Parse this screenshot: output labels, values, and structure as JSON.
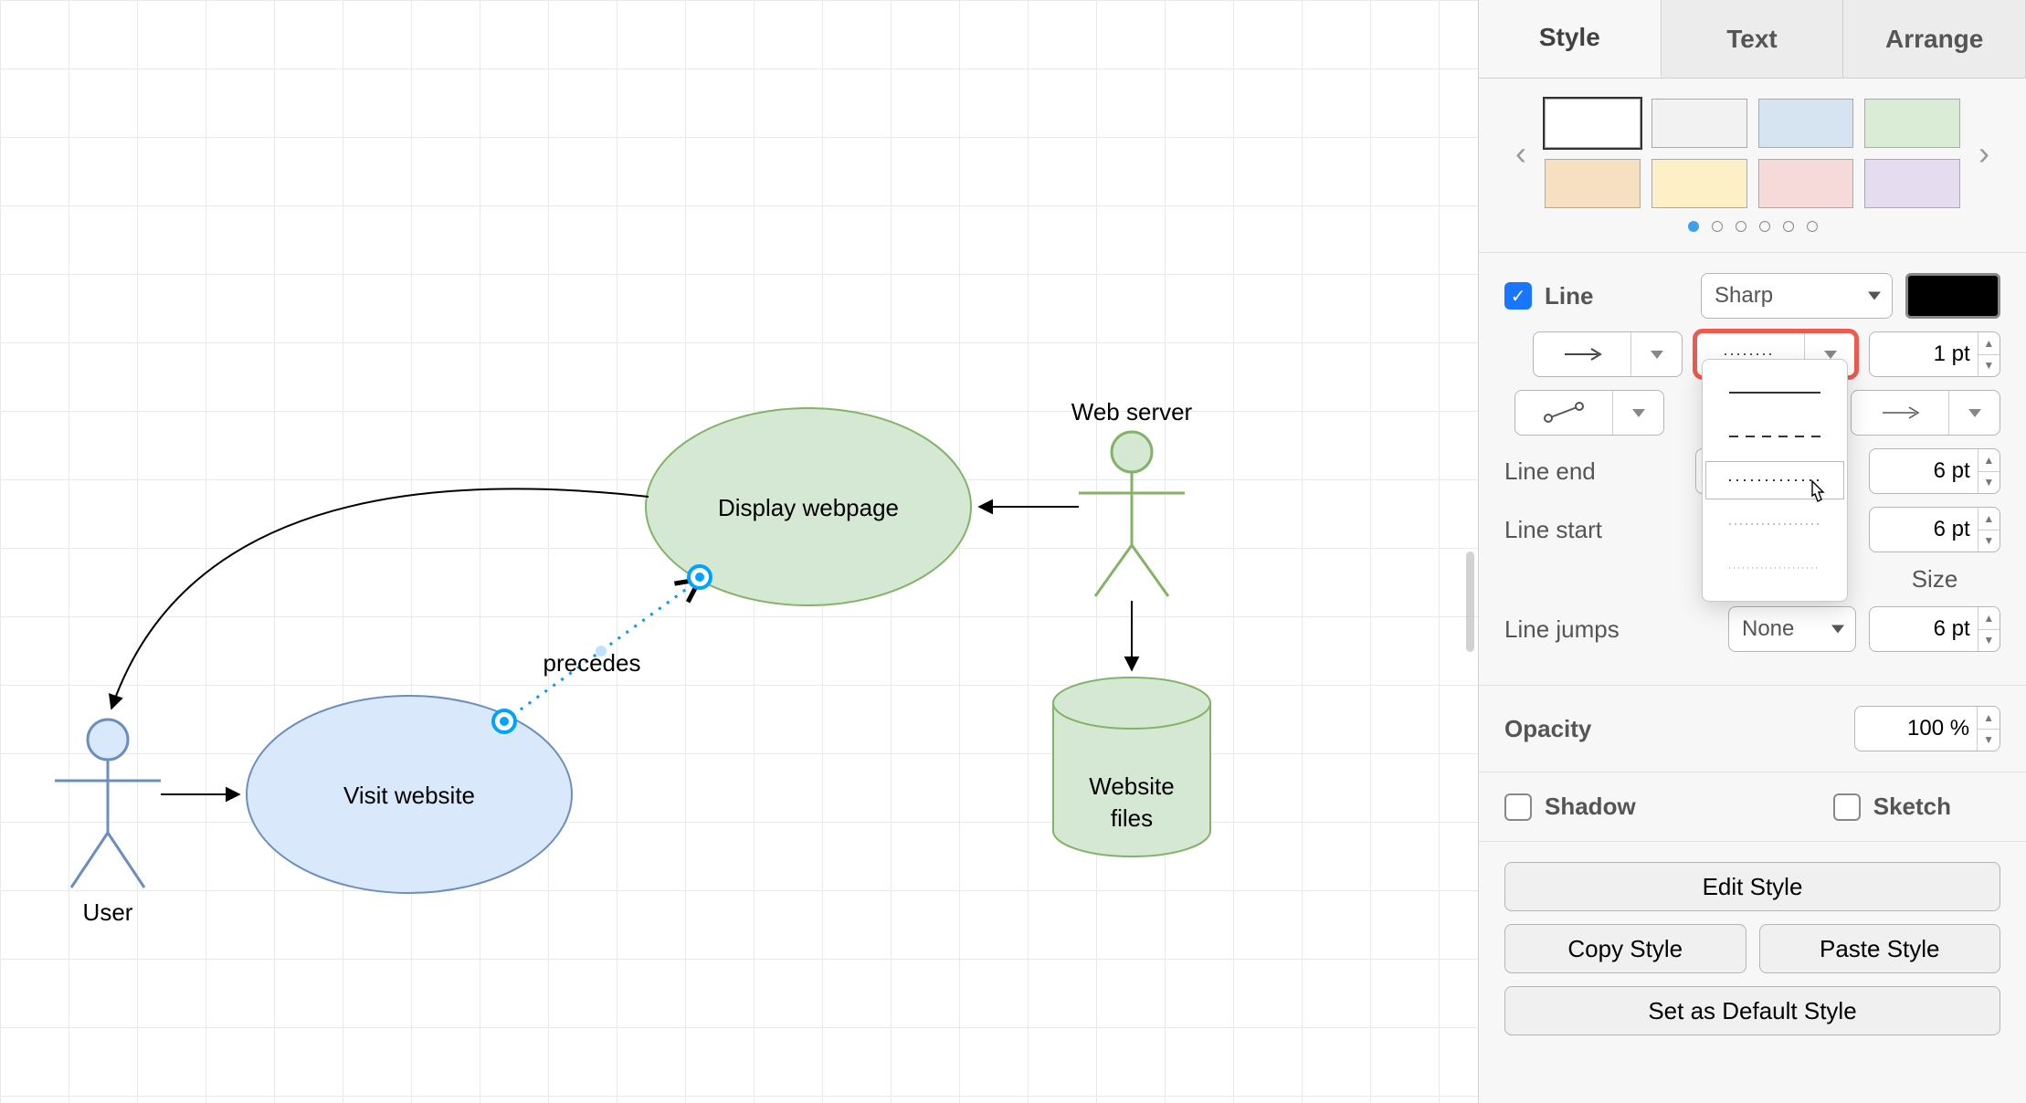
{
  "panel": {
    "tabs": {
      "style": "Style",
      "text": "Text",
      "arrange": "Arrange",
      "active": "style"
    },
    "palette": {
      "colors": [
        "#ffffff",
        "#f2f2f2",
        "#d6e4f2",
        "#dbecd6",
        "#f7e0c1",
        "#fdf0c6",
        "#f6dada",
        "#e5dcf0"
      ],
      "page_dots": 6,
      "active_dot": 0
    },
    "line": {
      "label": "Line",
      "checked": true,
      "curve": "Sharp",
      "color": "#000000",
      "width_value": "1 pt",
      "jumps_label": "Line jumps",
      "jumps_value": "None",
      "end_label": "Line end",
      "start_label": "Line start",
      "end_value": "6 pt",
      "start_value": "6 pt",
      "size_label": "Size",
      "jump_size_value": "6 pt"
    },
    "opacity": {
      "label": "Opacity",
      "value": "100 %"
    },
    "shadow": {
      "label": "Shadow",
      "checked": false
    },
    "sketch": {
      "label": "Sketch",
      "checked": false
    },
    "buttons": {
      "edit": "Edit Style",
      "copy": "Copy Style",
      "paste": "Paste Style",
      "default": "Set as Default Style"
    },
    "dash_options": [
      "solid",
      "dashed",
      "dash-dot",
      "dotted-fine",
      "dotted"
    ]
  },
  "canvas": {
    "nodes": {
      "user": {
        "label": "User",
        "type": "actor"
      },
      "webserver": {
        "label": "Web server",
        "type": "actor"
      },
      "visit": {
        "label": "Visit website",
        "type": "usecase"
      },
      "display": {
        "label": "Display webpage",
        "type": "usecase"
      },
      "store": {
        "label": "Website files",
        "type": "cylinder"
      }
    },
    "edges": {
      "precedes_label": "precedes"
    }
  },
  "icons": {
    "chev_left": "‹",
    "chev_right": "›",
    "check": "✓"
  }
}
